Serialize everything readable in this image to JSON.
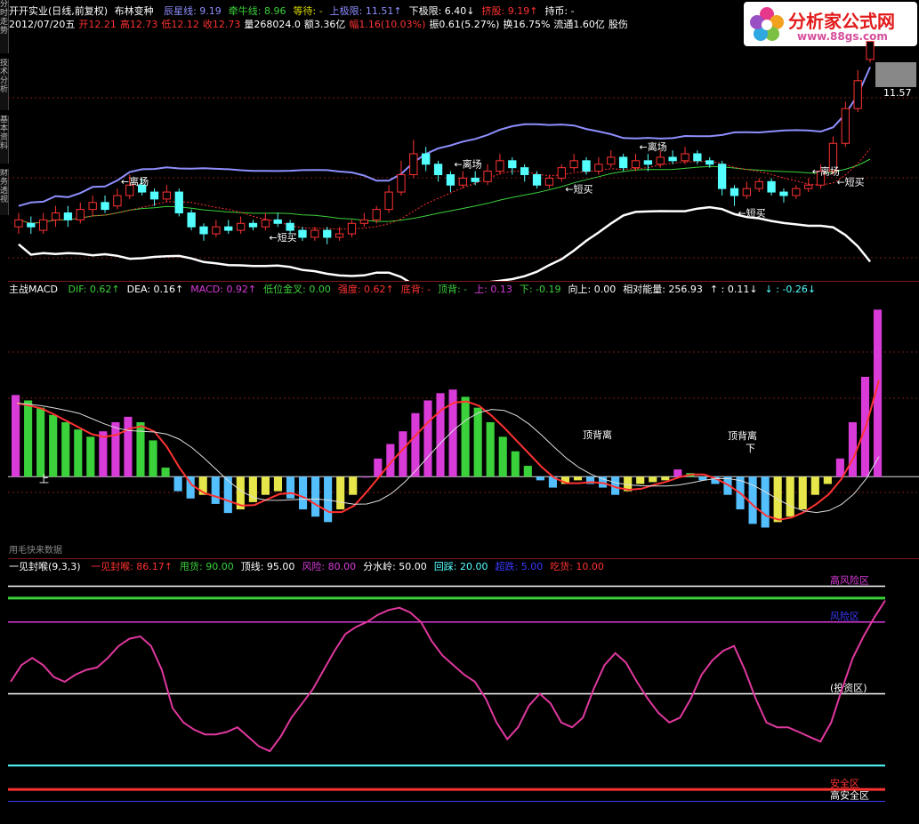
{
  "colors": {
    "up": "#ff3232",
    "down": "#54ffff",
    "grid": "#7a1a1a",
    "mid": "#8f8fff",
    "lower": "#ffffff",
    "ma": "#3bd13b"
  },
  "sidebar": [
    {
      "label": "分时走势"
    },
    {
      "label": "技术分析"
    },
    {
      "label": "基本资料"
    },
    {
      "label": "财务透视"
    }
  ],
  "header": {
    "title": "开开实业(日线,前复权)",
    "indicator": "布林变种",
    "line1": [
      {
        "label": "辰星线: 9.19",
        "color": "#8f8fff"
      },
      {
        "label": "牵牛线: 8.96",
        "color": "#3bd13b"
      },
      {
        "label": "等待: -",
        "color": "#d9d900"
      },
      {
        "label": "上极限: 11.51↑",
        "color": "#8f8fff"
      },
      {
        "label": "下极限: 6.40↓",
        "color": "#ffffff"
      },
      {
        "label": "挤股: 9.19↑",
        "color": "#ff3232"
      },
      {
        "label": "持币: -",
        "color": "#ffffff"
      }
    ],
    "line2": [
      {
        "label": "2012/07/20五",
        "color": "#ffffff"
      },
      {
        "label": "开12.21",
        "color": "#ff3232"
      },
      {
        "label": "高12.73",
        "color": "#ff3232"
      },
      {
        "label": "低12.12",
        "color": "#ff3232"
      },
      {
        "label": "收12.73",
        "color": "#ff3232"
      },
      {
        "label": "量268024.0",
        "color": "#ffffff"
      },
      {
        "label": "额3.36亿",
        "color": "#ffffff"
      },
      {
        "label": "幅1.16(10.03%)",
        "color": "#ff3232"
      },
      {
        "label": "振0.61(5.27%)",
        "color": "#ffffff"
      },
      {
        "label": "换16.75%",
        "color": "#ffffff"
      },
      {
        "label": "流通1.60亿",
        "color": "#ffffff"
      },
      {
        "label": "股伤",
        "color": "#ffffff"
      }
    ]
  },
  "logo": {
    "name": "分析家公式网",
    "url": "www.88gs.com"
  },
  "price_panel": {
    "price_tag": "11.57",
    "annotations": {
      "leave": "离场",
      "buy": "短买"
    },
    "chart_data": {
      "type": "candlestick",
      "candles": [
        {
          "o": 7.4,
          "c": 7.6,
          "h": 7.8,
          "l": 7.2
        },
        {
          "o": 7.5,
          "c": 7.4,
          "h": 7.7,
          "l": 7.2
        },
        {
          "o": 7.3,
          "c": 7.6,
          "h": 7.8,
          "l": 7.2
        },
        {
          "o": 7.6,
          "c": 7.8,
          "h": 8.0,
          "l": 7.4
        },
        {
          "o": 7.8,
          "c": 7.6,
          "h": 8.0,
          "l": 7.4
        },
        {
          "o": 7.6,
          "c": 7.9,
          "h": 8.1,
          "l": 7.5
        },
        {
          "o": 7.9,
          "c": 8.1,
          "h": 8.3,
          "l": 7.7
        },
        {
          "o": 8.1,
          "c": 7.9,
          "h": 8.3,
          "l": 7.8
        },
        {
          "o": 8.0,
          "c": 8.3,
          "h": 8.5,
          "l": 7.9
        },
        {
          "o": 8.3,
          "c": 8.6,
          "h": 8.9,
          "l": 8.2
        },
        {
          "o": 8.6,
          "c": 8.4,
          "h": 8.8,
          "l": 8.3
        },
        {
          "o": 8.4,
          "c": 8.2,
          "h": 8.5,
          "l": 8.0
        },
        {
          "o": 8.2,
          "c": 8.4,
          "h": 8.6,
          "l": 8.1
        },
        {
          "o": 8.4,
          "c": 7.8,
          "h": 8.5,
          "l": 7.7
        },
        {
          "o": 7.8,
          "c": 7.4,
          "h": 7.9,
          "l": 7.3
        },
        {
          "o": 7.4,
          "c": 7.2,
          "h": 7.5,
          "l": 7.0
        },
        {
          "o": 7.2,
          "c": 7.4,
          "h": 7.6,
          "l": 7.1
        },
        {
          "o": 7.4,
          "c": 7.3,
          "h": 7.6,
          "l": 7.2
        },
        {
          "o": 7.3,
          "c": 7.5,
          "h": 7.7,
          "l": 7.2
        },
        {
          "o": 7.5,
          "c": 7.4,
          "h": 7.6,
          "l": 7.3
        },
        {
          "o": 7.4,
          "c": 7.6,
          "h": 7.8,
          "l": 7.3
        },
        {
          "o": 7.6,
          "c": 7.5,
          "h": 7.8,
          "l": 7.4
        },
        {
          "o": 7.5,
          "c": 7.3,
          "h": 7.6,
          "l": 7.2
        },
        {
          "o": 7.3,
          "c": 7.1,
          "h": 7.4,
          "l": 7.0
        },
        {
          "o": 7.1,
          "c": 7.3,
          "h": 7.4,
          "l": 7.0
        },
        {
          "o": 7.3,
          "c": 7.1,
          "h": 7.4,
          "l": 6.9
        },
        {
          "o": 7.1,
          "c": 7.2,
          "h": 7.4,
          "l": 7.0
        },
        {
          "o": 7.2,
          "c": 7.5,
          "h": 7.6,
          "l": 7.1
        },
        {
          "o": 7.5,
          "c": 7.6,
          "h": 7.8,
          "l": 7.4
        },
        {
          "o": 7.6,
          "c": 7.9,
          "h": 8.0,
          "l": 7.5
        },
        {
          "o": 7.9,
          "c": 8.4,
          "h": 8.6,
          "l": 7.8
        },
        {
          "o": 8.4,
          "c": 8.9,
          "h": 9.3,
          "l": 8.3
        },
        {
          "o": 8.9,
          "c": 9.5,
          "h": 9.9,
          "l": 8.8
        },
        {
          "o": 9.5,
          "c": 9.2,
          "h": 9.7,
          "l": 9.0
        },
        {
          "o": 9.2,
          "c": 8.9,
          "h": 9.3,
          "l": 8.7
        },
        {
          "o": 8.9,
          "c": 8.6,
          "h": 9.0,
          "l": 8.4
        },
        {
          "o": 8.6,
          "c": 8.8,
          "h": 9.0,
          "l": 8.5
        },
        {
          "o": 8.8,
          "c": 8.7,
          "h": 9.0,
          "l": 8.6
        },
        {
          "o": 8.7,
          "c": 9.0,
          "h": 9.2,
          "l": 8.6
        },
        {
          "o": 9.0,
          "c": 9.3,
          "h": 9.5,
          "l": 8.9
        },
        {
          "o": 9.3,
          "c": 9.1,
          "h": 9.4,
          "l": 8.9
        },
        {
          "o": 9.1,
          "c": 8.9,
          "h": 9.2,
          "l": 8.7
        },
        {
          "o": 8.9,
          "c": 8.6,
          "h": 9.0,
          "l": 8.5
        },
        {
          "o": 8.6,
          "c": 8.8,
          "h": 8.9,
          "l": 8.5
        },
        {
          "o": 8.8,
          "c": 9.1,
          "h": 9.2,
          "l": 8.7
        },
        {
          "o": 9.1,
          "c": 9.3,
          "h": 9.5,
          "l": 9.0
        },
        {
          "o": 9.3,
          "c": 9.0,
          "h": 9.4,
          "l": 8.9
        },
        {
          "o": 9.0,
          "c": 9.2,
          "h": 9.4,
          "l": 8.9
        },
        {
          "o": 9.2,
          "c": 9.4,
          "h": 9.6,
          "l": 9.1
        },
        {
          "o": 9.4,
          "c": 9.1,
          "h": 9.5,
          "l": 9.0
        },
        {
          "o": 9.1,
          "c": 9.3,
          "h": 9.5,
          "l": 9.0
        },
        {
          "o": 9.3,
          "c": 9.2,
          "h": 9.5,
          "l": 9.0
        },
        {
          "o": 9.2,
          "c": 9.4,
          "h": 9.6,
          "l": 9.1
        },
        {
          "o": 9.4,
          "c": 9.3,
          "h": 9.6,
          "l": 9.2
        },
        {
          "o": 9.3,
          "c": 9.5,
          "h": 9.7,
          "l": 9.2
        },
        {
          "o": 9.5,
          "c": 9.3,
          "h": 9.6,
          "l": 9.2
        },
        {
          "o": 9.3,
          "c": 9.2,
          "h": 9.4,
          "l": 9.1
        },
        {
          "o": 9.2,
          "c": 8.5,
          "h": 9.3,
          "l": 8.3
        },
        {
          "o": 8.5,
          "c": 8.3,
          "h": 8.6,
          "l": 8.0
        },
        {
          "o": 8.3,
          "c": 8.5,
          "h": 8.7,
          "l": 8.2
        },
        {
          "o": 8.5,
          "c": 8.7,
          "h": 8.8,
          "l": 8.4
        },
        {
          "o": 8.7,
          "c": 8.4,
          "h": 8.8,
          "l": 8.3
        },
        {
          "o": 8.4,
          "c": 8.3,
          "h": 8.5,
          "l": 8.1
        },
        {
          "o": 8.3,
          "c": 8.5,
          "h": 8.6,
          "l": 8.2
        },
        {
          "o": 8.5,
          "c": 8.6,
          "h": 8.8,
          "l": 8.4
        },
        {
          "o": 8.6,
          "c": 9.0,
          "h": 9.2,
          "l": 8.5
        },
        {
          "o": 9.0,
          "c": 9.8,
          "h": 10.0,
          "l": 8.9
        },
        {
          "o": 9.8,
          "c": 10.8,
          "h": 11.0,
          "l": 9.7
        },
        {
          "o": 10.8,
          "c": 11.6,
          "h": 11.9,
          "l": 10.7
        },
        {
          "o": 12.21,
          "c": 12.73,
          "h": 12.73,
          "l": 12.12
        }
      ],
      "ylim": [
        6.0,
        13.0
      ]
    }
  },
  "macd_panel": {
    "title": "主战MACD",
    "values": [
      {
        "label": "DIF: 0.62↑",
        "color": "#3bd13b"
      },
      {
        "label": "DEA: 0.16↑",
        "color": "#ffffff"
      },
      {
        "label": "MACD: 0.92↑",
        "color": "#d93bd9"
      },
      {
        "label": "低位金叉: 0.00",
        "color": "#3bd13b"
      },
      {
        "label": "强度: 0.62↑",
        "color": "#ff3232"
      },
      {
        "label": "底背: -",
        "color": "#ff3232"
      },
      {
        "label": "顶背: -",
        "color": "#3bd13b"
      },
      {
        "label": "上: 0.13",
        "color": "#d93bd9"
      },
      {
        "label": "下: -0.19",
        "color": "#3bd13b"
      },
      {
        "label": "向上: 0.00",
        "color": "#ffffff"
      },
      {
        "label": "相对能量: 256.93",
        "color": "#ffffff"
      },
      {
        "label": "↑ : 0.11↓",
        "color": "#ffffff"
      },
      {
        "label": "↓ : -0.26↓",
        "color": "#54ffff"
      }
    ],
    "labels": {
      "top_div": "顶背离",
      "up": "上",
      "down": "下"
    },
    "footer": "用毛快来数据",
    "chart_data": {
      "type": "bar",
      "values": [
        0.45,
        0.42,
        0.38,
        0.34,
        0.3,
        0.26,
        0.22,
        0.25,
        0.3,
        0.33,
        0.3,
        0.2,
        0.05,
        -0.08,
        -0.12,
        -0.1,
        -0.15,
        -0.2,
        -0.18,
        -0.14,
        -0.1,
        -0.08,
        -0.12,
        -0.18,
        -0.22,
        -0.25,
        -0.18,
        -0.1,
        0.0,
        0.1,
        0.18,
        0.25,
        0.35,
        0.42,
        0.46,
        0.48,
        0.44,
        0.38,
        0.3,
        0.22,
        0.14,
        0.06,
        -0.02,
        -0.06,
        -0.04,
        -0.02,
        -0.04,
        -0.06,
        -0.1,
        -0.08,
        -0.04,
        -0.03,
        -0.02,
        0.04,
        0.02,
        -0.02,
        -0.04,
        -0.1,
        -0.18,
        -0.26,
        -0.28,
        -0.25,
        -0.22,
        -0.18,
        -0.1,
        -0.04,
        0.1,
        0.3,
        0.55,
        0.92
      ],
      "ylim": [
        -0.4,
        1.0
      ]
    }
  },
  "oscillator_panel": {
    "title": "一见封喉(9,3,3)",
    "values": [
      {
        "label": "一见封喉: 86.17↑",
        "color": "#ff3232"
      },
      {
        "label": "甩货: 90.00",
        "color": "#3bd13b"
      },
      {
        "label": "顶线: 95.00",
        "color": "#ffffff"
      },
      {
        "label": "风险: 80.00",
        "color": "#d93bd9"
      },
      {
        "label": "分水岭: 50.00",
        "color": "#ffffff"
      },
      {
        "label": "回踩: 20.00",
        "color": "#54ffff"
      },
      {
        "label": "超跌: 5.00",
        "color": "#3a3aff"
      },
      {
        "label": "吃货: 10.00",
        "color": "#ff3232"
      }
    ],
    "zones": [
      {
        "label": "高风险区",
        "value": 95,
        "color": "#ffffff",
        "text_color": "#d93bd9"
      },
      {
        "label": "风险区",
        "value": 80,
        "color": "#d93bd9",
        "text_color": "#3a3aff"
      },
      {
        "label": "(投资区)",
        "value": 50,
        "color": "#ffffff",
        "text_color": "#ffffff"
      },
      {
        "label": "安全区",
        "value": 10,
        "color": "#ff3232",
        "text_color": "#ff3232"
      },
      {
        "label": "高安全区",
        "value": 5,
        "color": "#3a3aff",
        "text_color": "#ffffff"
      }
    ],
    "greenline": 90,
    "cyanline": 20,
    "chart_data": {
      "type": "line",
      "values": [
        55,
        62,
        65,
        62,
        57,
        55,
        58,
        60,
        61,
        65,
        70,
        73,
        74,
        70,
        60,
        44,
        38,
        35,
        33,
        33,
        34,
        36,
        32,
        28,
        26,
        32,
        40,
        46,
        52,
        60,
        68,
        75,
        78,
        80,
        83,
        85,
        86,
        84,
        80,
        72,
        66,
        62,
        58,
        55,
        48,
        38,
        31,
        36,
        45,
        50,
        46,
        38,
        36,
        40,
        52,
        62,
        67,
        63,
        55,
        48,
        42,
        38,
        40,
        48,
        58,
        64,
        68,
        70,
        60,
        48,
        38,
        36,
        36,
        34,
        32,
        30,
        38,
        52,
        65,
        74,
        82,
        89
      ]
    }
  }
}
